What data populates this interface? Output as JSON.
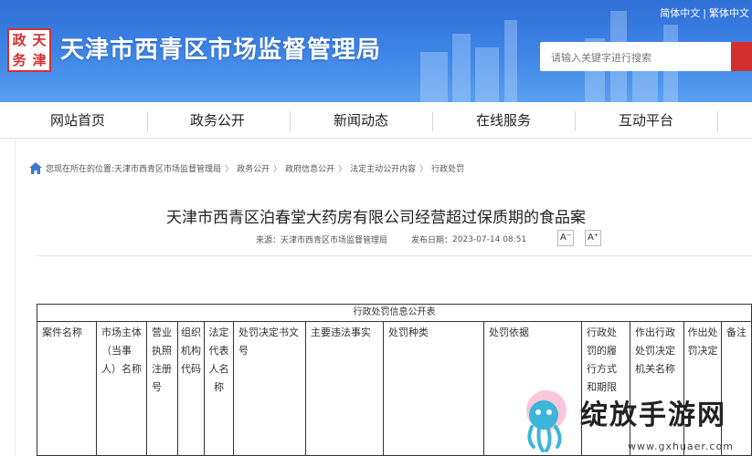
{
  "header": {
    "logo_chars": [
      "政",
      "天",
      "务",
      "津"
    ],
    "title": "天津市西青区市场监督管理局",
    "lang": [
      "简体中文",
      "繁体中文"
    ],
    "search_placeholder": "请输入关键字进行搜索",
    "colors": {
      "banner": "#3f86e8",
      "accent": "#d32f2f"
    }
  },
  "nav": {
    "items": [
      "网站首页",
      "政务公开",
      "新闻动态",
      "在线服务",
      "互动平台"
    ]
  },
  "breadcrumb": {
    "prefix": "您现在所在的位置:",
    "items": [
      "天津市西青区市场监督管理局",
      "政务公开",
      "政府信息公开",
      "法定主动公开内容",
      "行政处罚"
    ],
    "separator": "〉"
  },
  "article": {
    "title": "天津市西青区泊春堂大药房有限公司经营超过保质期的食品案",
    "source_label": "来源：",
    "source": "天津市西青区市场监督管理局",
    "date_label": "发布日期：",
    "date": "2023-07-14 08:51",
    "font_smaller": "A⁻",
    "font_larger": "A⁺"
  },
  "table": {
    "caption": "行政处罚信息公开表",
    "headers": [
      "案件名称",
      "市场主体（当事人）名称",
      "营业执照注册号",
      "组织机构代码",
      "法定代表人名称",
      "处罚决定书文号",
      "主要违法事实",
      "处罚种类",
      "处罚依据",
      "行政处罚的履行方式和期限",
      "作出行政处罚决定机关名称",
      "作出处罚决定",
      "备注"
    ]
  },
  "watermark": {
    "text": "绽放手游网",
    "url": "www.gxhuaer.com"
  }
}
